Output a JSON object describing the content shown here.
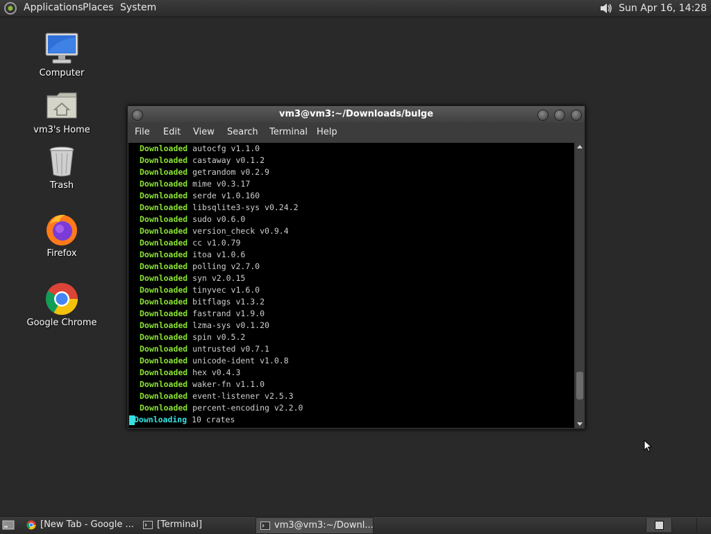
{
  "top_panel": {
    "menus": [
      "Applications",
      "Places",
      "System"
    ],
    "clock": "Sun Apr 16, 14:28"
  },
  "desktop": {
    "icons": [
      {
        "label": "Computer",
        "icon": "computer-icon"
      },
      {
        "label": "vm3's Home",
        "icon": "home-folder-icon"
      },
      {
        "label": "Trash",
        "icon": "trash-icon"
      },
      {
        "label": "Firefox",
        "icon": "firefox-icon"
      },
      {
        "label": "Google Chrome",
        "icon": "chrome-icon"
      }
    ]
  },
  "terminal": {
    "title": "vm3@vm3:~/Downloads/bulge",
    "menu": [
      "File",
      "Edit",
      "View",
      "Search",
      "Terminal",
      "Help"
    ],
    "lines": [
      {
        "status": "Downloaded",
        "text": "autocfg v1.1.0"
      },
      {
        "status": "Downloaded",
        "text": "castaway v0.1.2"
      },
      {
        "status": "Downloaded",
        "text": "getrandom v0.2.9"
      },
      {
        "status": "Downloaded",
        "text": "mime v0.3.17"
      },
      {
        "status": "Downloaded",
        "text": "serde v1.0.160"
      },
      {
        "status": "Downloaded",
        "text": "libsqlite3-sys v0.24.2"
      },
      {
        "status": "Downloaded",
        "text": "sudo v0.6.0"
      },
      {
        "status": "Downloaded",
        "text": "version_check v0.9.4"
      },
      {
        "status": "Downloaded",
        "text": "cc v1.0.79"
      },
      {
        "status": "Downloaded",
        "text": "itoa v1.0.6"
      },
      {
        "status": "Downloaded",
        "text": "polling v2.7.0"
      },
      {
        "status": "Downloaded",
        "text": "syn v2.0.15"
      },
      {
        "status": "Downloaded",
        "text": "tinyvec v1.6.0"
      },
      {
        "status": "Downloaded",
        "text": "bitflags v1.3.2"
      },
      {
        "status": "Downloaded",
        "text": "fastrand v1.9.0"
      },
      {
        "status": "Downloaded",
        "text": "lzma-sys v0.1.20"
      },
      {
        "status": "Downloaded",
        "text": "spin v0.5.2"
      },
      {
        "status": "Downloaded",
        "text": "untrusted v0.7.1"
      },
      {
        "status": "Downloaded",
        "text": "unicode-ident v1.0.8"
      },
      {
        "status": "Downloaded",
        "text": "hex v0.4.3"
      },
      {
        "status": "Downloaded",
        "text": "waker-fn v1.1.0"
      },
      {
        "status": "Downloaded",
        "text": "event-listener v2.5.3"
      },
      {
        "status": "Downloaded",
        "text": "percent-encoding v2.2.0"
      },
      {
        "status": "Downloading",
        "text": "10 crates"
      }
    ],
    "scroll_position": 0.92
  },
  "taskbar": {
    "tasks": [
      {
        "label": "[New Tab - Google ...",
        "icon": "chrome-icon",
        "active": false
      },
      {
        "label": "[Terminal]",
        "icon": "terminal-icon",
        "active": false
      },
      {
        "label": "vm3@vm3:~/Downl...",
        "icon": "terminal-icon",
        "active": true
      }
    ]
  }
}
